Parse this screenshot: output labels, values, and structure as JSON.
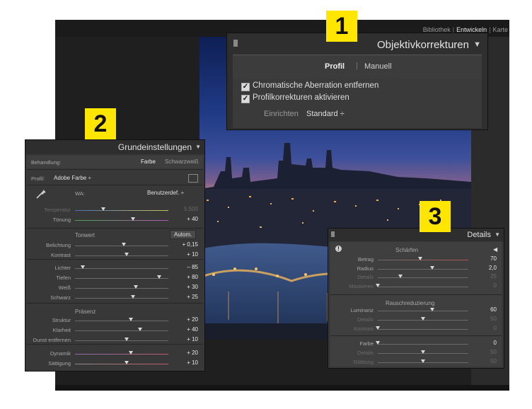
{
  "modules": {
    "library": "Bibliothek",
    "develop": "Entwickeln",
    "map": "Karte"
  },
  "badges": {
    "b1": "1",
    "b2": "2",
    "b3": "3"
  },
  "lens_panel": {
    "title": "Objektivkorrekturen",
    "tab_profile": "Profil",
    "tab_separator": "|",
    "tab_manual": "Manuell",
    "check1": "Chromatische Aberration entfernen",
    "check2": "Profilkorrekturen aktivieren",
    "setup_label": "Einrichten",
    "setup_value": "Standard ÷"
  },
  "basic_panel": {
    "title": "Grundeinstellungen",
    "treatment_label": "Behandlung:",
    "treatment_color": "Farbe",
    "treatment_bw": "Schwarzweiß",
    "profile_label": "Profil:",
    "profile_value": "Adobe Farbe ÷",
    "wb_label": "WA:",
    "wb_value": "Benutzerdef. ÷",
    "tone_head": "Tonwert",
    "auto_button": "Autom.",
    "presence_head": "Präsenz",
    "sliders": [
      {
        "label": "Temperatur",
        "value": "5.500",
        "pos": 0.3
      },
      {
        "label": "Tönung",
        "value": "+ 40",
        "pos": 0.62
      },
      {
        "label": "Belichtung",
        "value": "+ 0,15",
        "pos": 0.52
      },
      {
        "label": "Kontrast",
        "value": "+ 10",
        "pos": 0.55
      },
      {
        "label": "Lichter",
        "value": "– 85",
        "pos": 0.08
      },
      {
        "label": "Tiefen",
        "value": "+ 80",
        "pos": 0.9
      },
      {
        "label": "Weiß",
        "value": "+ 30",
        "pos": 0.65
      },
      {
        "label": "Schwarz",
        "value": "+ 25",
        "pos": 0.62
      },
      {
        "label": "Struktur",
        "value": "+ 20",
        "pos": 0.6
      },
      {
        "label": "Klarheit",
        "value": "+ 40",
        "pos": 0.7
      },
      {
        "label": "Dunst entfernen",
        "value": "+ 10",
        "pos": 0.55
      },
      {
        "label": "Dynamik",
        "value": "+ 20",
        "pos": 0.6
      },
      {
        "label": "Sättigung",
        "value": "+ 10",
        "pos": 0.55
      }
    ]
  },
  "detail_panel": {
    "title": "Details",
    "sharpen_head": "Schärfen",
    "noise_head": "Rauschreduzierung",
    "sliders": [
      {
        "label": "Betrag",
        "value": "70",
        "pos": 0.47
      },
      {
        "label": "Radius",
        "value": "2,0",
        "pos": 0.6
      },
      {
        "label": "Details",
        "value": "25",
        "pos": 0.25
      },
      {
        "label": "Maskieren",
        "value": "0",
        "pos": 0.0
      },
      {
        "label": "Luminanz",
        "value": "60",
        "pos": 0.6
      },
      {
        "label": "Details",
        "value": "50",
        "pos": 0.5
      },
      {
        "label": "Kontrast",
        "value": "0",
        "pos": 0.0
      },
      {
        "label": "Farbe",
        "value": "0",
        "pos": 0.0
      },
      {
        "label": "Details",
        "value": "50",
        "pos": 0.5
      },
      {
        "label": "Glättung",
        "value": "50",
        "pos": 0.5
      }
    ]
  }
}
